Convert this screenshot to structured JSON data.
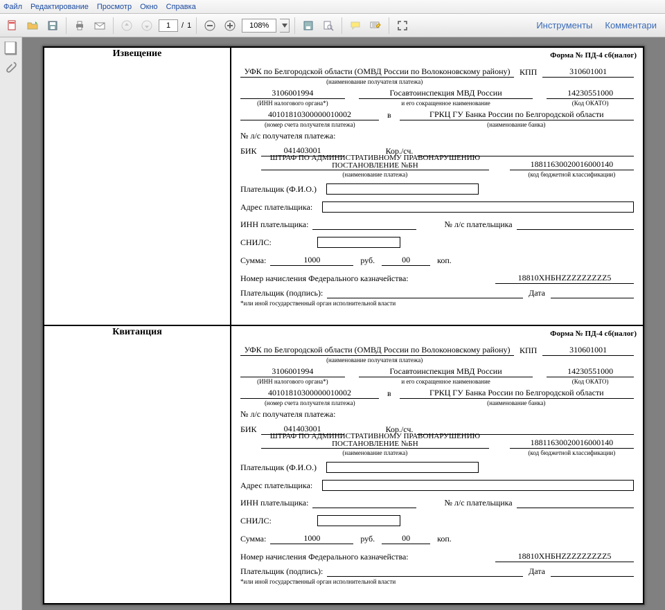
{
  "menu": {
    "file": "Файл",
    "edit": "Редактирование",
    "view": "Просмотр",
    "window": "Окно",
    "help": "Справка"
  },
  "toolbar": {
    "page_current": "1",
    "page_sep": "/",
    "page_total": "1",
    "zoom": "108%",
    "instruments": "Инструменты",
    "comments": "Комментари"
  },
  "form": {
    "header": "Форма № ПД-4 сб(налог)",
    "section_notice": "Извещение",
    "section_receipt": "Квитанция",
    "recipient": "УФК по Белгородской области (ОМВД России по Волоконовскому району)",
    "recipient_cap": "(наименование получателя платежа)",
    "kpp_lab": "КПП",
    "kpp": "310601001",
    "inn": "3106001994",
    "inn_cap": "(ИНН налогового органа*)",
    "org": "Госавтоинспекция МВД России",
    "org_cap": "и его сокращенное наименование",
    "okato": "14230551000",
    "okato_cap": "(Код ОКАТО)",
    "acct": "40101810300000010002",
    "acct_cap": "(номер счета получателя платежа)",
    "in": "в",
    "bank": "ГРКЦ ГУ Банка России по Белгородской области",
    "bank_cap": "(наименование банка)",
    "ls_recipient": "№ л/с получателя платежа:",
    "bik_lab": "БИК",
    "bik": "041403001",
    "korsch": "Кор./сч.",
    "payment_name": "ШТРАФ ПО АДМИНИСТРАТИВНОМУ ПРАВОНАРУШЕНИЮ ПОСТАНОВЛЕНИЕ №БН",
    "payment_name_cap": "(наименование платежа)",
    "kbk": "18811630020016000140",
    "kbk_cap": "(код бюджетной классификации)",
    "payer_fio": "Плательщик (Ф.И.О.)",
    "payer_addr": "Адрес плательщика:",
    "payer_inn": "ИНН плательщика:",
    "payer_ls": "№ л/с плательщика",
    "snils": "СНИЛС:",
    "sum_lab": "Сумма:",
    "sum_rub": "1000",
    "rub": "руб.",
    "sum_kop": "00",
    "kop": "коп.",
    "treasury": "Номер начисления Федерального казначейства:",
    "treasury_num": "18810ХНБНZZZZZZZZZ5",
    "payer_sign": "Плательщик (подпись):",
    "date": "Дата",
    "footnote": "*или иной государственный орган исполнительной власти"
  }
}
